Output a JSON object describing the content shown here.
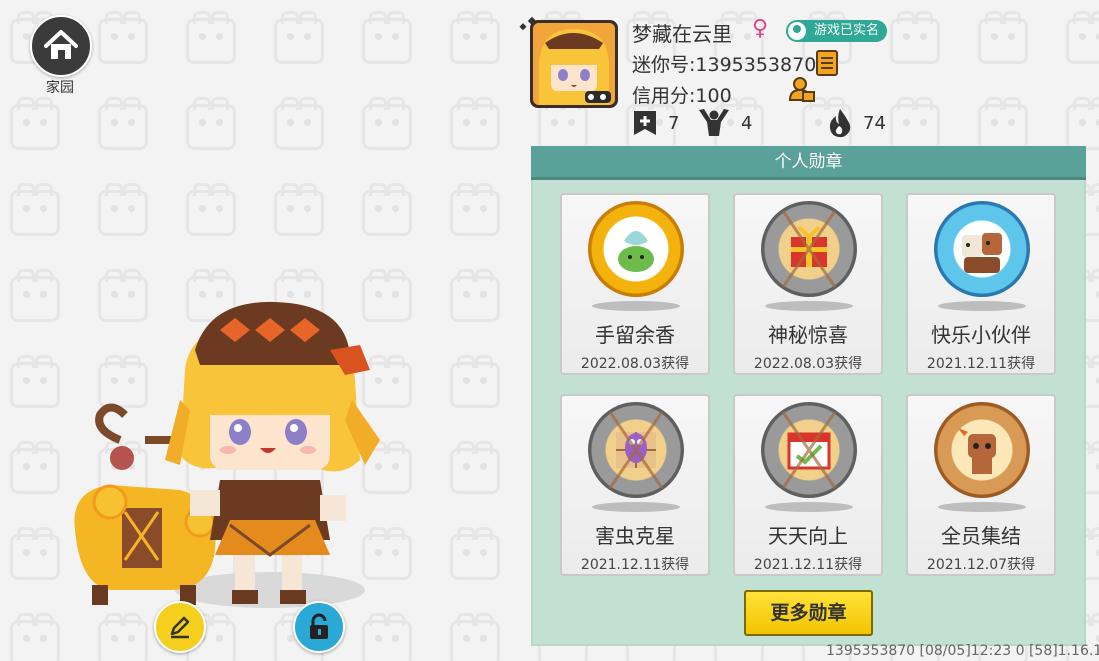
{
  "home": {
    "label": "家园",
    "icon": "house-icon"
  },
  "profile": {
    "name": "梦藏在云里",
    "gender_symbol": "♀",
    "realname_badge": "游戏已实名",
    "mini_id": "迷你号:1395353870",
    "credit": "信用分:100",
    "stats": {
      "flags": "7",
      "fans": "4",
      "heat": "74"
    }
  },
  "medals": {
    "title": "个人勋章",
    "items": [
      {
        "name": "手留余香",
        "date": "2022.08.03获得"
      },
      {
        "name": "神秘惊喜",
        "date": "2022.08.03获得"
      },
      {
        "name": "快乐小伙伴",
        "date": "2021.12.11获得"
      },
      {
        "name": "害虫克星",
        "date": "2021.12.11获得"
      },
      {
        "name": "天天向上",
        "date": "2021.12.11获得"
      },
      {
        "name": "全员集结",
        "date": "2021.12.07获得"
      }
    ],
    "more_label": "更多勋章"
  },
  "footer": "1395353870    [08/05]12:23 0  [58]1.16.1",
  "colors": {
    "panel_bg": "#c2e1d2",
    "panel_header": "#5aa199",
    "more_button": "#f5d21a",
    "gender": "#e0468a",
    "badge": "#2fa895"
  }
}
